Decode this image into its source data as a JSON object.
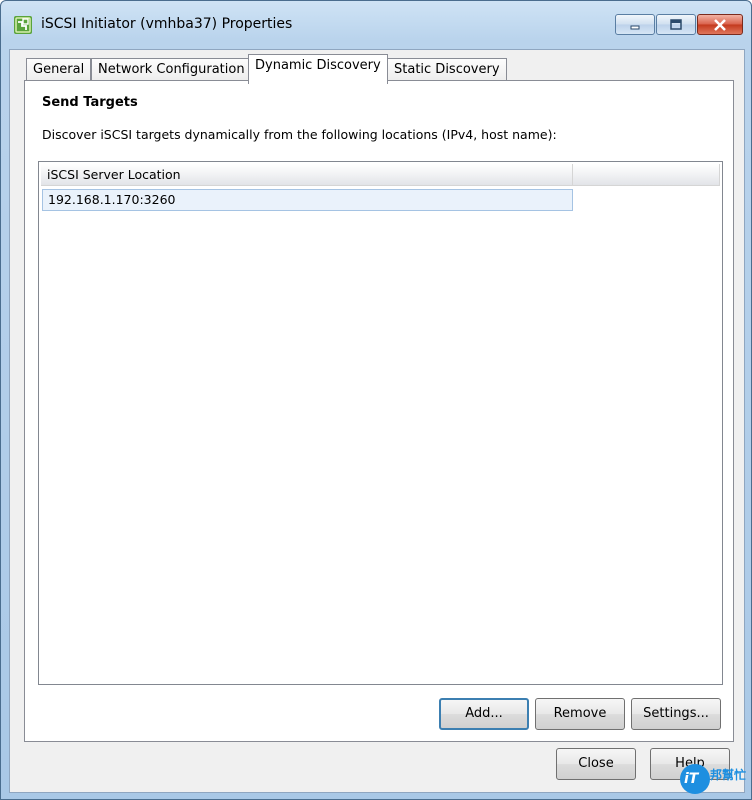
{
  "window": {
    "title": "iSCSI Initiator (vmhba37) Properties",
    "icon": "vsphere-app-icon"
  },
  "tabs": [
    {
      "label": "General",
      "active": false
    },
    {
      "label": "Network Configuration",
      "active": false
    },
    {
      "label": "Dynamic Discovery",
      "active": true
    },
    {
      "label": "Static Discovery",
      "active": false
    }
  ],
  "panel": {
    "section_title": "Send Targets",
    "description": "Discover iSCSI targets dynamically from the following locations (IPv4, host name):"
  },
  "list": {
    "columns": [
      "iSCSI Server Location",
      ""
    ],
    "rows": [
      "192.168.1.170:3260"
    ]
  },
  "buttons": {
    "add": "Add...",
    "remove": "Remove",
    "settings": "Settings...",
    "close": "Close",
    "help": "Help"
  },
  "watermark": {
    "logo_text": "iT",
    "text": "邦幫忙"
  },
  "colors": {
    "title_gradient_top": "#cfe3f5",
    "close_button": "#c3391d",
    "selection": "#eaf2fb",
    "default_button_border": "#3c7fb1"
  }
}
